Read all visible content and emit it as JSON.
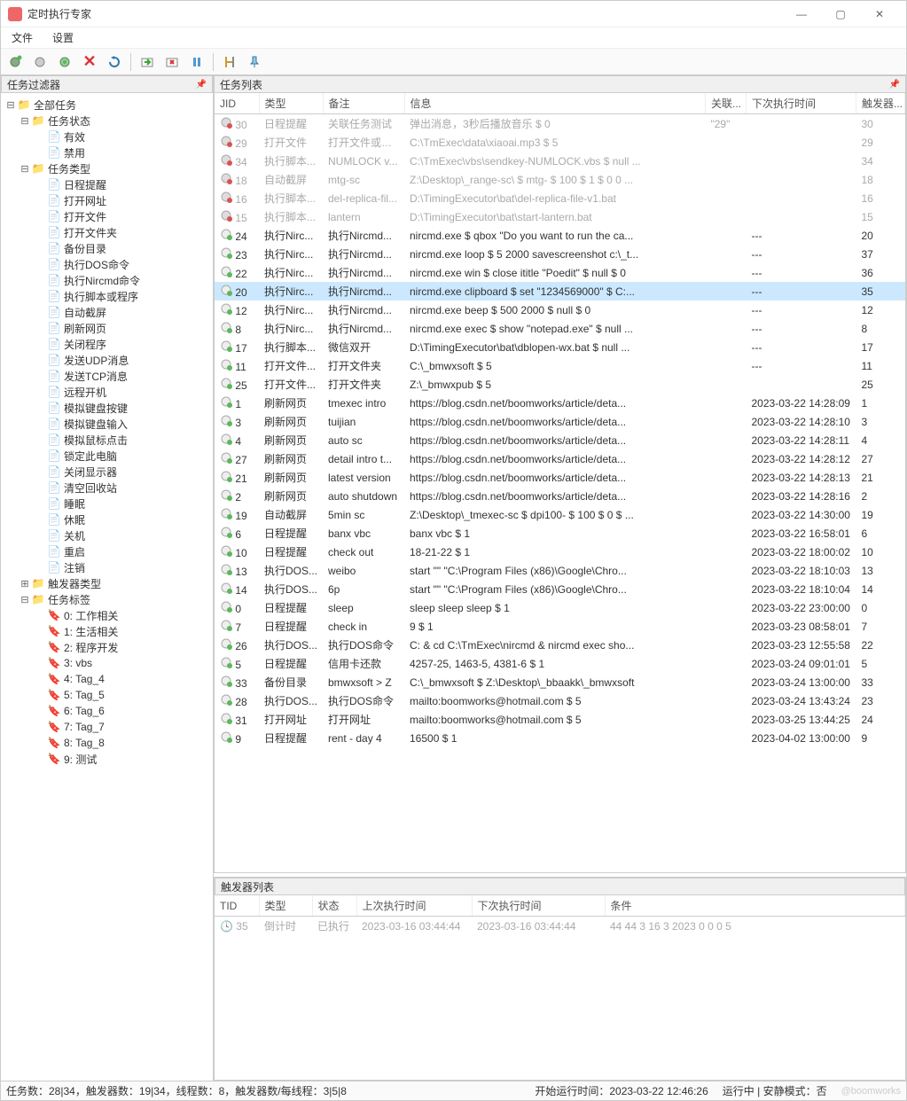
{
  "app": {
    "title": "定时执行专家"
  },
  "menu": {
    "file": "文件",
    "settings": "设置"
  },
  "toolbar": {
    "new": "新建",
    "newgrp": "新组",
    "newtrg": "新触发",
    "delete": "删除",
    "refresh": "刷新",
    "import": "导入",
    "export": "导出",
    "pause": "暂停",
    "options": "选项",
    "pin": "固定"
  },
  "panels": {
    "filter_title": "任务过滤器",
    "tasklist_title": "任务列表",
    "trigger_title": "触发器列表"
  },
  "tree": {
    "root": "全部任务",
    "status": {
      "label": "任务状态",
      "enabled": "有效",
      "disabled": "禁用"
    },
    "types": {
      "label": "任务类型",
      "items": [
        "日程提醒",
        "打开网址",
        "打开文件",
        "打开文件夹",
        "备份目录",
        "执行DOS命令",
        "执行Nircmd命令",
        "执行脚本或程序",
        "自动截屏",
        "刷新网页",
        "关闭程序",
        "发送UDP消息",
        "发送TCP消息",
        "远程开机",
        "模拟键盘按键",
        "模拟键盘输入",
        "模拟鼠标点击",
        "锁定此电脑",
        "关闭显示器",
        "清空回收站",
        "睡眠",
        "休眠",
        "关机",
        "重启",
        "注销"
      ]
    },
    "triggers": "触发器类型",
    "tags": {
      "label": "任务标签",
      "items": [
        "0: 工作相关",
        "1: 生活相关",
        "2: 程序开发",
        "3: vbs",
        "4: Tag_4",
        "5: Tag_5",
        "6: Tag_6",
        "7: Tag_7",
        "8: Tag_8",
        "9: 测试"
      ]
    }
  },
  "task_cols": {
    "jid": "JID",
    "type": "类型",
    "note": "备注",
    "info": "信息",
    "rel": "关联...",
    "next": "下次执行时间",
    "trig": "触发器..."
  },
  "tasks": [
    {
      "st": "off",
      "jid": "30",
      "type": "日程提醒",
      "note": "关联任务测试",
      "info": "弹出消息，3秒后播放音乐 $ 0",
      "rel": "\"29\"",
      "next": "",
      "trig": "30",
      "dis": true
    },
    {
      "st": "off",
      "jid": "29",
      "type": "打开文件",
      "note": "打开文件或程序",
      "info": "C:\\TmExec\\data\\xiaoai.mp3 $ 5",
      "rel": "",
      "next": "",
      "trig": "29",
      "dis": true
    },
    {
      "st": "off",
      "jid": "34",
      "type": "执行脚本...",
      "note": "NUMLOCK v...",
      "info": "C:\\TmExec\\vbs\\sendkey-NUMLOCK.vbs $ null ...",
      "rel": "",
      "next": "",
      "trig": "34",
      "dis": true
    },
    {
      "st": "off",
      "jid": "18",
      "type": "自动截屏",
      "note": "mtg-sc",
      "info": "Z:\\Desktop\\_range-sc\\ $ mtg- $ 100 $ 1 $ 0 0 ...",
      "rel": "",
      "next": "",
      "trig": "18",
      "dis": true
    },
    {
      "st": "off",
      "jid": "16",
      "type": "执行脚本...",
      "note": "del-replica-fil...",
      "info": "D:\\TimingExecutor\\bat\\del-replica-file-v1.bat",
      "rel": "",
      "next": "",
      "trig": "16",
      "dis": true
    },
    {
      "st": "off",
      "jid": "15",
      "type": "执行脚本...",
      "note": "lantern",
      "info": "D:\\TimingExecutor\\bat\\start-lantern.bat",
      "rel": "",
      "next": "",
      "trig": "15",
      "dis": true
    },
    {
      "st": "ok",
      "jid": "24",
      "type": "执行Nirc...",
      "note": "执行Nircmd...",
      "info": "nircmd.exe $ qbox \"Do you want to run the ca...",
      "rel": "",
      "next": "---",
      "trig": "20"
    },
    {
      "st": "ok",
      "jid": "23",
      "type": "执行Nirc...",
      "note": "执行Nircmd...",
      "info": "nircmd.exe loop $ 5 2000 savescreenshot c:\\_t...",
      "rel": "",
      "next": "---",
      "trig": "37"
    },
    {
      "st": "ok",
      "jid": "22",
      "type": "执行Nirc...",
      "note": "执行Nircmd...",
      "info": "nircmd.exe win $ close ititle \"Poedit\" $ null $ 0",
      "rel": "",
      "next": "---",
      "trig": "36"
    },
    {
      "st": "ok",
      "jid": "20",
      "type": "执行Nirc...",
      "note": "执行Nircmd...",
      "info": "nircmd.exe clipboard $ set \"1234569000\" $ C:...",
      "rel": "",
      "next": "---",
      "trig": "35",
      "sel": true
    },
    {
      "st": "ok",
      "jid": "12",
      "type": "执行Nirc...",
      "note": "执行Nircmd...",
      "info": "nircmd.exe beep $ 500 2000 $ null $ 0",
      "rel": "",
      "next": "---",
      "trig": "12"
    },
    {
      "st": "ok",
      "jid": "8",
      "type": "执行Nirc...",
      "note": "执行Nircmd...",
      "info": "nircmd.exe exec $ show \"notepad.exe\" $ null ...",
      "rel": "",
      "next": "---",
      "trig": "8"
    },
    {
      "st": "ok",
      "jid": "17",
      "type": "执行脚本...",
      "note": "微信双开",
      "info": "D:\\TimingExecutor\\bat\\dblopen-wx.bat $ null ...",
      "rel": "",
      "next": "---",
      "trig": "17"
    },
    {
      "st": "ok",
      "jid": "11",
      "type": "打开文件...",
      "note": "打开文件夹",
      "info": "C:\\_bmwxsoft $ 5",
      "rel": "",
      "next": "---",
      "trig": "11"
    },
    {
      "st": "ok",
      "jid": "25",
      "type": "打开文件...",
      "note": "打开文件夹",
      "info": "Z:\\_bmwxpub $ 5",
      "rel": "",
      "next": "",
      "trig": "25"
    },
    {
      "st": "ok",
      "jid": "1",
      "type": "刷新网页",
      "note": "tmexec intro",
      "info": "https://blog.csdn.net/boomworks/article/deta...",
      "rel": "",
      "next": "2023-03-22 14:28:09",
      "trig": "1"
    },
    {
      "st": "ok",
      "jid": "3",
      "type": "刷新网页",
      "note": "tuijian",
      "info": "https://blog.csdn.net/boomworks/article/deta...",
      "rel": "",
      "next": "2023-03-22 14:28:10",
      "trig": "3"
    },
    {
      "st": "ok",
      "jid": "4",
      "type": "刷新网页",
      "note": "auto sc",
      "info": "https://blog.csdn.net/boomworks/article/deta...",
      "rel": "",
      "next": "2023-03-22 14:28:11",
      "trig": "4"
    },
    {
      "st": "ok",
      "jid": "27",
      "type": "刷新网页",
      "note": "detail intro t...",
      "info": "https://blog.csdn.net/boomworks/article/deta...",
      "rel": "",
      "next": "2023-03-22 14:28:12",
      "trig": "27"
    },
    {
      "st": "ok",
      "jid": "21",
      "type": "刷新网页",
      "note": "latest version",
      "info": "https://blog.csdn.net/boomworks/article/deta...",
      "rel": "",
      "next": "2023-03-22 14:28:13",
      "trig": "21"
    },
    {
      "st": "ok",
      "jid": "2",
      "type": "刷新网页",
      "note": "auto shutdown",
      "info": "https://blog.csdn.net/boomworks/article/deta...",
      "rel": "",
      "next": "2023-03-22 14:28:16",
      "trig": "2"
    },
    {
      "st": "ok",
      "jid": "19",
      "type": "自动截屏",
      "note": "5min sc",
      "info": "Z:\\Desktop\\_tmexec-sc $ dpi100- $ 100 $ 0 $ ...",
      "rel": "",
      "next": "2023-03-22 14:30:00",
      "trig": "19"
    },
    {
      "st": "ok",
      "jid": "6",
      "type": "日程提醒",
      "note": "banx vbc",
      "info": "banx vbc $ 1",
      "rel": "",
      "next": "2023-03-22 16:58:01",
      "trig": "6"
    },
    {
      "st": "ok",
      "jid": "10",
      "type": "日程提醒",
      "note": "check out",
      "info": "18-21-22 $ 1",
      "rel": "",
      "next": "2023-03-22 18:00:02",
      "trig": "10"
    },
    {
      "st": "ok",
      "jid": "13",
      "type": "执行DOS...",
      "note": "weibo",
      "info": "start \"\" \"C:\\Program Files (x86)\\Google\\Chro...",
      "rel": "",
      "next": "2023-03-22 18:10:03",
      "trig": "13"
    },
    {
      "st": "ok",
      "jid": "14",
      "type": "执行DOS...",
      "note": "6p",
      "info": "start \"\" \"C:\\Program Files (x86)\\Google\\Chro...",
      "rel": "",
      "next": "2023-03-22 18:10:04",
      "trig": "14"
    },
    {
      "st": "ok",
      "jid": "0",
      "type": "日程提醒",
      "note": "sleep",
      "info": "sleep sleep sleep $ 1",
      "rel": "",
      "next": "2023-03-22 23:00:00",
      "trig": "0"
    },
    {
      "st": "ok",
      "jid": "7",
      "type": "日程提醒",
      "note": "check in",
      "info": "9 $ 1",
      "rel": "",
      "next": "2023-03-23 08:58:01",
      "trig": "7"
    },
    {
      "st": "ok",
      "jid": "26",
      "type": "执行DOS...",
      "note": "执行DOS命令",
      "info": "C: & cd C:\\TmExec\\nircmd & nircmd exec sho...",
      "rel": "",
      "next": "2023-03-23 12:55:58",
      "trig": "22"
    },
    {
      "st": "ok",
      "jid": "5",
      "type": "日程提醒",
      "note": "信用卡还款",
      "info": "4257-25, 1463-5, 4381-6 $ 1",
      "rel": "",
      "next": "2023-03-24 09:01:01",
      "trig": "5"
    },
    {
      "st": "ok",
      "jid": "33",
      "type": "备份目录",
      "note": "bmwxsoft > Z",
      "info": "C:\\_bmwxsoft $ Z:\\Desktop\\_bbaakk\\_bmwxsoft",
      "rel": "",
      "next": "2023-03-24 13:00:00",
      "trig": "33"
    },
    {
      "st": "ok",
      "jid": "28",
      "type": "执行DOS...",
      "note": "执行DOS命令",
      "info": "mailto:boomworks@hotmail.com $ 5",
      "rel": "",
      "next": "2023-03-24 13:43:24",
      "trig": "23"
    },
    {
      "st": "ok",
      "jid": "31",
      "type": "打开网址",
      "note": "打开网址",
      "info": "mailto:boomworks@hotmail.com $ 5",
      "rel": "",
      "next": "2023-03-25 13:44:25",
      "trig": "24"
    },
    {
      "st": "ok",
      "jid": "9",
      "type": "日程提醒",
      "note": "rent - day 4",
      "info": "16500 $ 1",
      "rel": "",
      "next": "2023-04-02 13:00:00",
      "trig": "9"
    }
  ],
  "trig_cols": {
    "tid": "TID",
    "type": "类型",
    "state": "状态",
    "last": "上次执行时间",
    "next": "下次执行时间",
    "cond": "条件"
  },
  "triggers": [
    {
      "tid": "35",
      "type": "倒计时",
      "state": "已执行",
      "last": "2023-03-16 03:44:44",
      "next": "2023-03-16 03:44:44",
      "cond": "44 44 3 16 3 2023 0 0 0 5",
      "dis": true
    }
  ],
  "status": {
    "tasks": "任务数：28|34，触发器数：19|34，线程数：8，触发器数/每线程：3|5|8",
    "start": "开始运行时间：2023-03-22 12:46:26",
    "mode": "运行中 | 安静模式：否",
    "watermark": "@boomworks"
  }
}
